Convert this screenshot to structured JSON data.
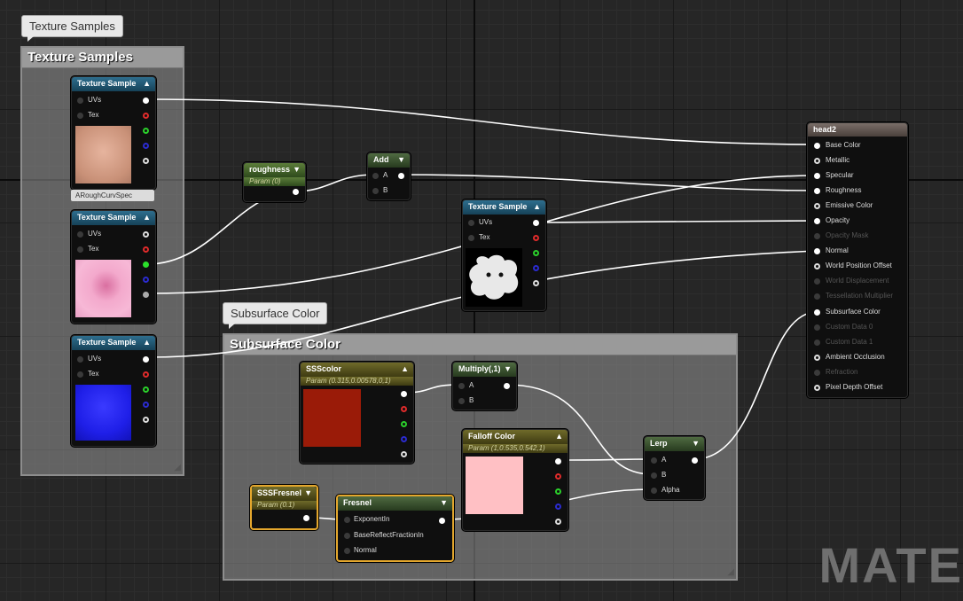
{
  "comments": {
    "texture_bubble": "Texture Samples",
    "texture_title": "Texture Samples",
    "subsurface_bubble": "Subsurface Color",
    "subsurface_title": "Subsurface Color"
  },
  "nodes": {
    "tex1": {
      "title": "Texture Sample",
      "pins": [
        "UVs",
        "Tex"
      ]
    },
    "tex2": {
      "title": "Texture Sample",
      "pins": [
        "UVs",
        "Tex"
      ],
      "label": "ARoughCurvSpec"
    },
    "tex3": {
      "title": "Texture Sample",
      "pins": [
        "UVs",
        "Tex"
      ]
    },
    "tex4": {
      "title": "Texture Sample",
      "pins": [
        "UVs",
        "Tex"
      ]
    },
    "roughness": {
      "title": "roughness",
      "sub": "Param (0)"
    },
    "add": {
      "title": "Add",
      "pins": [
        "A",
        "B"
      ]
    },
    "sss_color": {
      "title": "SSScolor",
      "sub": "Param (0.315,0.00578,0,1)",
      "swatch": "#9a1b08"
    },
    "multiply": {
      "title": "Multiply(,1)",
      "pins": [
        "A",
        "B"
      ]
    },
    "falloff": {
      "title": "Falloff Color",
      "sub": "Param (1,0.535,0.542,1)",
      "swatch": "#ffc0c4"
    },
    "lerp": {
      "title": "Lerp",
      "pins": [
        "A",
        "B",
        "Alpha"
      ]
    },
    "sss_fresnel": {
      "title": "SSSFresnel",
      "sub": "Param (0.1)"
    },
    "fresnel": {
      "title": "Fresnel",
      "pins": [
        "ExponentIn",
        "BaseReflectFractionIn",
        "Normal"
      ]
    },
    "material": {
      "title": "head2",
      "pins": [
        "Base Color",
        "Metallic",
        "Specular",
        "Roughness",
        "Emissive Color",
        "Opacity",
        "Opacity Mask",
        "Normal",
        "World Position Offset",
        "World Displacement",
        "Tessellation Multiplier",
        "Subsurface Color",
        "Custom Data 0",
        "Custom Data 1",
        "Ambient Occlusion",
        "Refraction",
        "Pixel Depth Offset"
      ]
    }
  },
  "watermark": "MATE"
}
